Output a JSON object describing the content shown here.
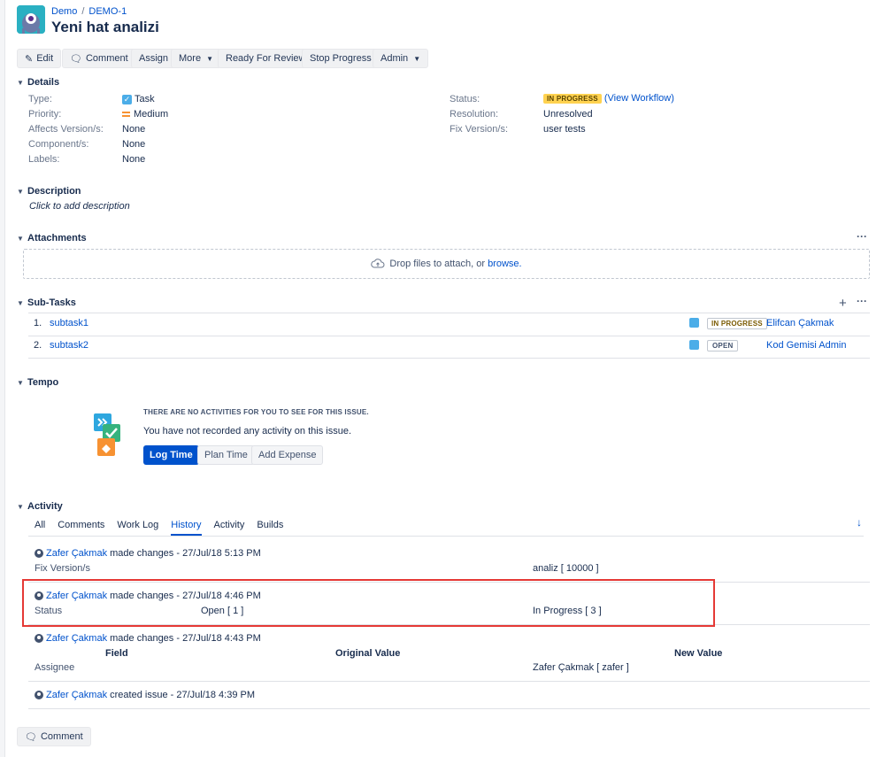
{
  "breadcrumb": {
    "project": "Demo",
    "separator": "/",
    "issue_key": "DEMO-1"
  },
  "issue_title": "Yeni hat analizi",
  "toolbar": {
    "edit": "Edit",
    "comment": "Comment",
    "assign": "Assign",
    "more": "More",
    "ready_for_review": "Ready For Review",
    "stop_progress": "Stop Progress",
    "admin": "Admin"
  },
  "details": {
    "heading": "Details",
    "type_label": "Type:",
    "type_value": "Task",
    "priority_label": "Priority:",
    "priority_value": "Medium",
    "affects_label": "Affects Version/s:",
    "affects_value": "None",
    "component_label": "Component/s:",
    "component_value": "None",
    "labels_label": "Labels:",
    "labels_value": "None",
    "status_label": "Status:",
    "status_value": "IN PROGRESS",
    "view_workflow": "(View Workflow)",
    "resolution_label": "Resolution:",
    "resolution_value": "Unresolved",
    "fix_label": "Fix Version/s:",
    "fix_value": "user tests"
  },
  "description": {
    "heading": "Description",
    "placeholder": "Click to add description"
  },
  "attachments": {
    "heading": "Attachments",
    "drop_text": "Drop files to attach, or",
    "browse": "browse.",
    "more": "···"
  },
  "subtasks": {
    "heading": "Sub-Tasks",
    "add": "+",
    "more": "···",
    "items": [
      {
        "num": "1.",
        "name": "subtask1",
        "status": "IN PROGRESS",
        "assignee": "Elifcan Çakmak"
      },
      {
        "num": "2.",
        "name": "subtask2",
        "status": "OPEN",
        "assignee": "Kod Gemisi Admin"
      }
    ]
  },
  "tempo": {
    "heading": "Tempo",
    "empty_title": "THERE ARE NO ACTIVITIES FOR YOU TO SEE FOR THIS ISSUE.",
    "empty_text": "You have not recorded any activity on this issue.",
    "log_time": "Log Time",
    "plan_time": "Plan Time",
    "add_expense": "Add Expense"
  },
  "activity": {
    "heading": "Activity",
    "tabs": [
      "All",
      "Comments",
      "Work Log",
      "History",
      "Activity",
      "Builds"
    ],
    "active_tab": "History",
    "sort_icon": "↓",
    "entries": [
      {
        "user": "Zafer Çakmak",
        "action": "made changes - 27/Jul/18 5:13 PM",
        "field": "Fix Version/s",
        "original": "",
        "new": "analiz [ 10000 ]"
      },
      {
        "user": "Zafer Çakmak",
        "action": "made changes - 27/Jul/18 4:46 PM",
        "field": "Status",
        "original": "Open [ 1 ]",
        "new": "In Progress [ 3 ]"
      },
      {
        "user": "Zafer Çakmak",
        "action": "made changes - 27/Jul/18 4:43 PM",
        "field": "Assignee",
        "original": "",
        "new": "Zafer Çakmak [ zafer ]"
      },
      {
        "user": "Zafer Çakmak",
        "action": "created issue - 27/Jul/18 4:39 PM"
      }
    ],
    "col_field": "Field",
    "col_original": "Original Value",
    "col_new": "New Value"
  },
  "bottom_comment": "Comment",
  "colors": {
    "link": "#0052cc",
    "in_progress": "#ffd250",
    "log_time": "#0052cc",
    "highlight": "#e53935"
  }
}
